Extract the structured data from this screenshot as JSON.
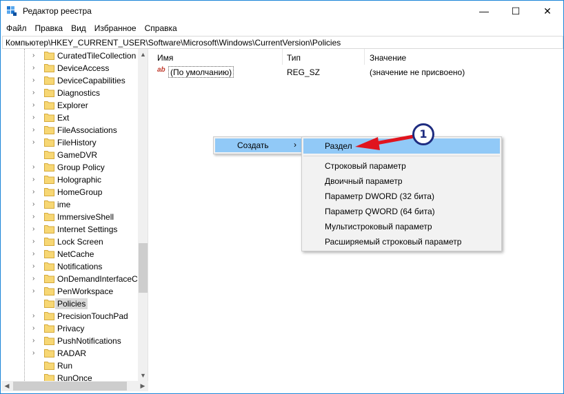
{
  "window": {
    "title": "Редактор реестра",
    "controls": {
      "minimize": "—",
      "maximize": "☐",
      "close": "✕"
    }
  },
  "menubar": [
    "Файл",
    "Правка",
    "Вид",
    "Избранное",
    "Справка"
  ],
  "address": "Компьютер\\HKEY_CURRENT_USER\\Software\\Microsoft\\Windows\\CurrentVersion\\Policies",
  "tree": {
    "items": [
      {
        "label": "CuratedTileCollection",
        "expandable": true
      },
      {
        "label": "DeviceAccess",
        "expandable": true
      },
      {
        "label": "DeviceCapabilities",
        "expandable": true
      },
      {
        "label": "Diagnostics",
        "expandable": true
      },
      {
        "label": "Explorer",
        "expandable": true
      },
      {
        "label": "Ext",
        "expandable": true
      },
      {
        "label": "FileAssociations",
        "expandable": true
      },
      {
        "label": "FileHistory",
        "expandable": true
      },
      {
        "label": "GameDVR",
        "expandable": false
      },
      {
        "label": "Group Policy",
        "expandable": true
      },
      {
        "label": "Holographic",
        "expandable": true
      },
      {
        "label": "HomeGroup",
        "expandable": true
      },
      {
        "label": "ime",
        "expandable": true
      },
      {
        "label": "ImmersiveShell",
        "expandable": true
      },
      {
        "label": "Internet Settings",
        "expandable": true
      },
      {
        "label": "Lock Screen",
        "expandable": true
      },
      {
        "label": "NetCache",
        "expandable": true
      },
      {
        "label": "Notifications",
        "expandable": true
      },
      {
        "label": "OnDemandInterfaceC",
        "expandable": true
      },
      {
        "label": "PenWorkspace",
        "expandable": true
      },
      {
        "label": "Policies",
        "expandable": false,
        "selected": true
      },
      {
        "label": "PrecisionTouchPad",
        "expandable": true
      },
      {
        "label": "Privacy",
        "expandable": true
      },
      {
        "label": "PushNotifications",
        "expandable": true
      },
      {
        "label": "RADAR",
        "expandable": true
      },
      {
        "label": "Run",
        "expandable": false
      },
      {
        "label": "RunOnce",
        "expandable": false
      }
    ],
    "scroll_up": "▲",
    "scroll_down": "▼",
    "scroll_left": "◀",
    "scroll_right": "▶"
  },
  "values_pane": {
    "columns": [
      "Имя",
      "Тип",
      "Значение"
    ],
    "rows": [
      {
        "icon": "ab",
        "name": "(По умолчанию)",
        "type": "REG_SZ",
        "data": "(значение не присвоено)"
      }
    ]
  },
  "context_menu": {
    "create_label": "Создать",
    "create_chevron": "›",
    "submenu": {
      "key_item": "Раздел",
      "items": [
        "Строковый параметр",
        "Двоичный параметр",
        "Параметр DWORD (32 бита)",
        "Параметр QWORD (64 бита)",
        "Мультистроковый параметр",
        "Расширяемый строковый параметр"
      ]
    }
  },
  "annotation": {
    "badge": "1",
    "arrow_color": "#e0141e",
    "badge_color": "#1e2c80"
  },
  "colors": {
    "highlight": "#91c9f7",
    "menu_bg": "#f2f2f2",
    "folder": "#f7d774",
    "selected": "#d9d9d9"
  }
}
